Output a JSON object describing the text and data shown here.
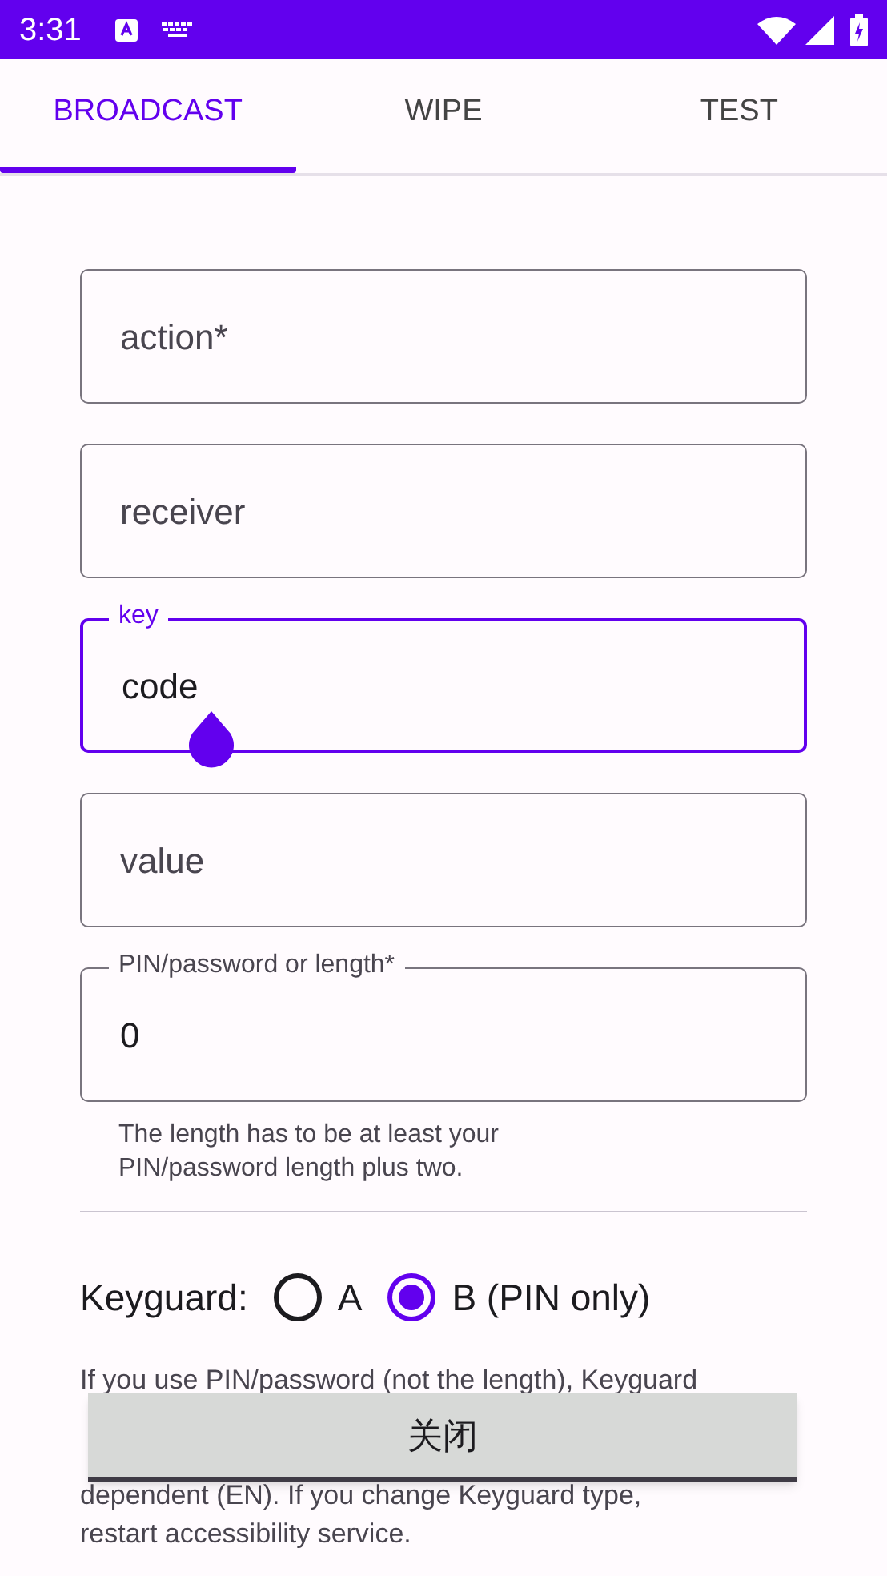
{
  "status_bar": {
    "time": "3:31"
  },
  "tabs": [
    {
      "label": "BROADCAST",
      "selected": true
    },
    {
      "label": "WIPE",
      "selected": false
    },
    {
      "label": "TEST",
      "selected": false
    }
  ],
  "fields": [
    {
      "placeholder": "action*"
    },
    {
      "placeholder": "receiver"
    },
    {
      "label": "key",
      "value": "code",
      "focused": true
    },
    {
      "placeholder": "value"
    },
    {
      "label": "PIN/password or length*",
      "value": "0",
      "focused": false,
      "helper": "The length has to be at least your PIN/password length plus two."
    }
  ],
  "keyguard": {
    "label": "Keyguard:",
    "options": [
      {
        "label": "A",
        "selected": false
      },
      {
        "label": "B (PIN only)",
        "selected": true
      }
    ]
  },
  "note": {
    "top_line": "If you use PIN/password (not the length), Keyguard",
    "bottom_lines": [
      "dependent (EN). If you change Keyguard type,",
      "restart accessibility service."
    ]
  },
  "toast": {
    "text": "关闭"
  }
}
